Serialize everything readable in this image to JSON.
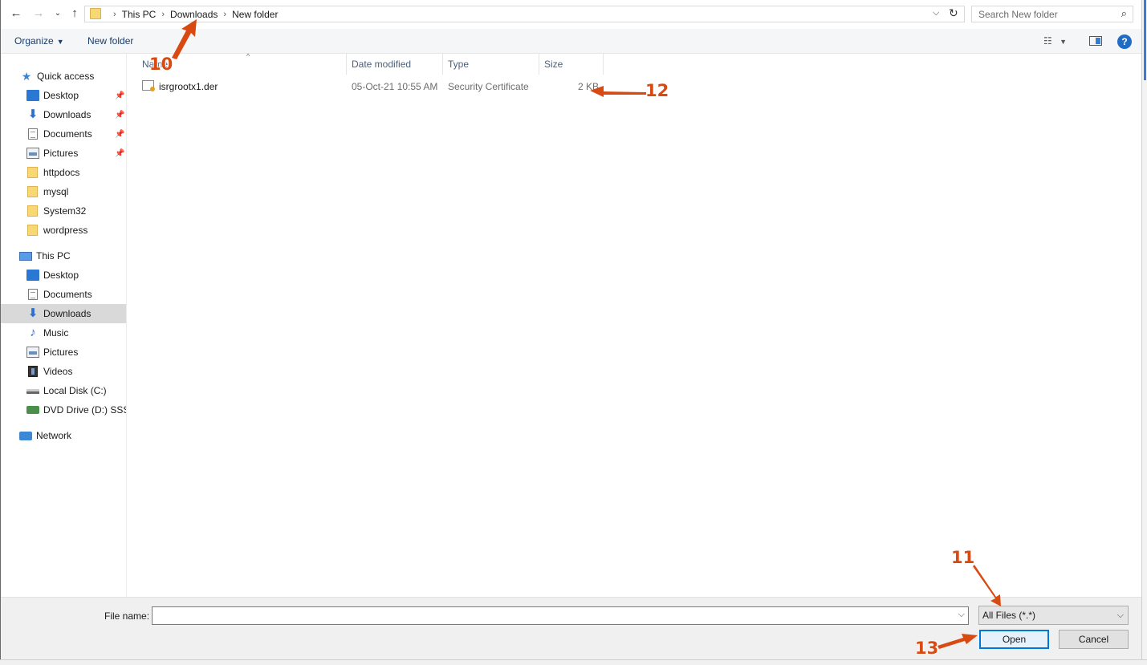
{
  "address_bar": {
    "breadcrumbs": [
      "This PC",
      "Downloads",
      "New folder"
    ],
    "search_placeholder": "Search New folder"
  },
  "toolbar": {
    "organize_label": "Organize",
    "new_folder_label": "New folder"
  },
  "nav_pane": {
    "quick_access": {
      "label": "Quick access",
      "items": [
        {
          "label": "Desktop",
          "icon": "desktop-icon",
          "pinned": true
        },
        {
          "label": "Downloads",
          "icon": "downloads-icon",
          "pinned": true
        },
        {
          "label": "Documents",
          "icon": "documents-icon",
          "pinned": true
        },
        {
          "label": "Pictures",
          "icon": "pictures-icon",
          "pinned": true
        },
        {
          "label": "httpdocs",
          "icon": "folder-icon",
          "pinned": false
        },
        {
          "label": "mysql",
          "icon": "folder-icon",
          "pinned": false
        },
        {
          "label": "System32",
          "icon": "folder-icon",
          "pinned": false
        },
        {
          "label": "wordpress",
          "icon": "folder-icon",
          "pinned": false
        }
      ]
    },
    "this_pc": {
      "label": "This PC",
      "items": [
        {
          "label": "Desktop",
          "icon": "desktop-icon"
        },
        {
          "label": "Documents",
          "icon": "documents-icon"
        },
        {
          "label": "Downloads",
          "icon": "downloads-icon",
          "selected": true
        },
        {
          "label": "Music",
          "icon": "music-icon"
        },
        {
          "label": "Pictures",
          "icon": "pictures-icon"
        },
        {
          "label": "Videos",
          "icon": "videos-icon"
        },
        {
          "label": "Local Disk (C:)",
          "icon": "local-disk-icon"
        },
        {
          "label": "DVD Drive (D:) SSS_X",
          "icon": "dvd-drive-icon"
        }
      ]
    },
    "network": {
      "label": "Network"
    }
  },
  "file_list": {
    "columns": {
      "name": "Name",
      "date_modified": "Date modified",
      "type": "Type",
      "size": "Size"
    },
    "rows": [
      {
        "name": "isrgrootx1.der",
        "date_modified": "05-Oct-21 10:55 AM",
        "type": "Security Certificate",
        "size": "2 KB"
      }
    ]
  },
  "bottom": {
    "file_name_label": "File name:",
    "file_name_value": "",
    "file_type_value": "All Files (*.*)",
    "open_label": "Open",
    "cancel_label": "Cancel"
  },
  "annotations": [
    "10",
    "11",
    "12",
    "13"
  ],
  "colors": {
    "annotation": "#d84a12",
    "accent": "#0078d7",
    "selected_nav": "#d9d9d9"
  }
}
